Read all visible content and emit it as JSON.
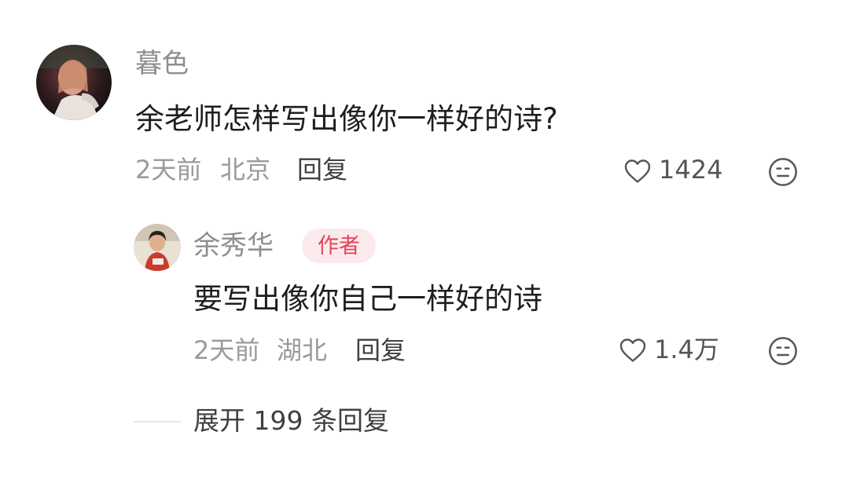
{
  "comment": {
    "username": "暮色",
    "text": "余老师怎样写出像你一样好的诗?",
    "time": "2天前",
    "location": "北京",
    "reply_label": "回复",
    "likes": "1424"
  },
  "reply": {
    "username": "余秀华",
    "badge": "作者",
    "text": "要写出像你自己一样好的诗",
    "time": "2天前",
    "location": "湖北",
    "reply_label": "回复",
    "likes": "1.4万"
  },
  "expand": {
    "label": "展开 199 条回复"
  },
  "icons": {
    "like": "heart-outline-icon",
    "dislike": "neutral-face-icon"
  },
  "colors": {
    "author_badge_bg": "#fbeaec",
    "author_badge_text": "#e3435a"
  }
}
